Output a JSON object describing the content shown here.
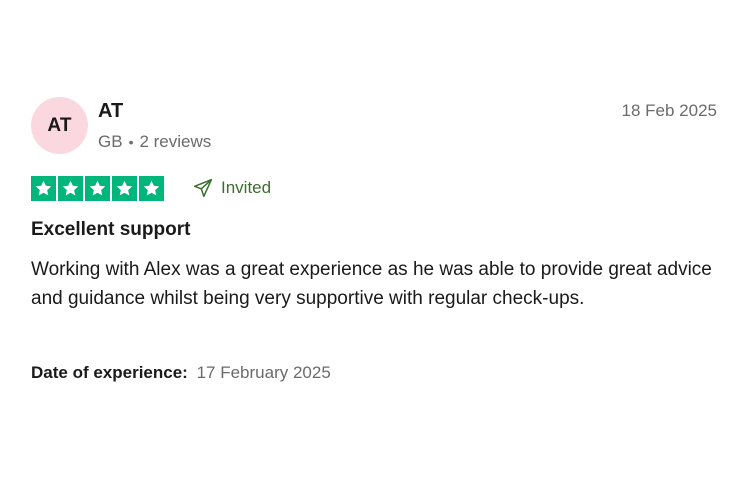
{
  "reviewer": {
    "initials": "AT",
    "name": "AT",
    "country": "GB",
    "review_count": "2 reviews",
    "avatar_color": "#fbd8df"
  },
  "review": {
    "date": "18 Feb 2025",
    "rating": 5,
    "star_color": "#00b67a",
    "badge_icon": "paper-plane-icon",
    "badge_label": "Invited",
    "badge_color": "#3d6e2c",
    "title": "Excellent support",
    "body": "Working with Alex was a great experience as he was able to provide great advice and guidance whilst being very supportive with regular check-ups.",
    "experience_label": "Date of experience:",
    "experience_date": "17 February 2025"
  }
}
